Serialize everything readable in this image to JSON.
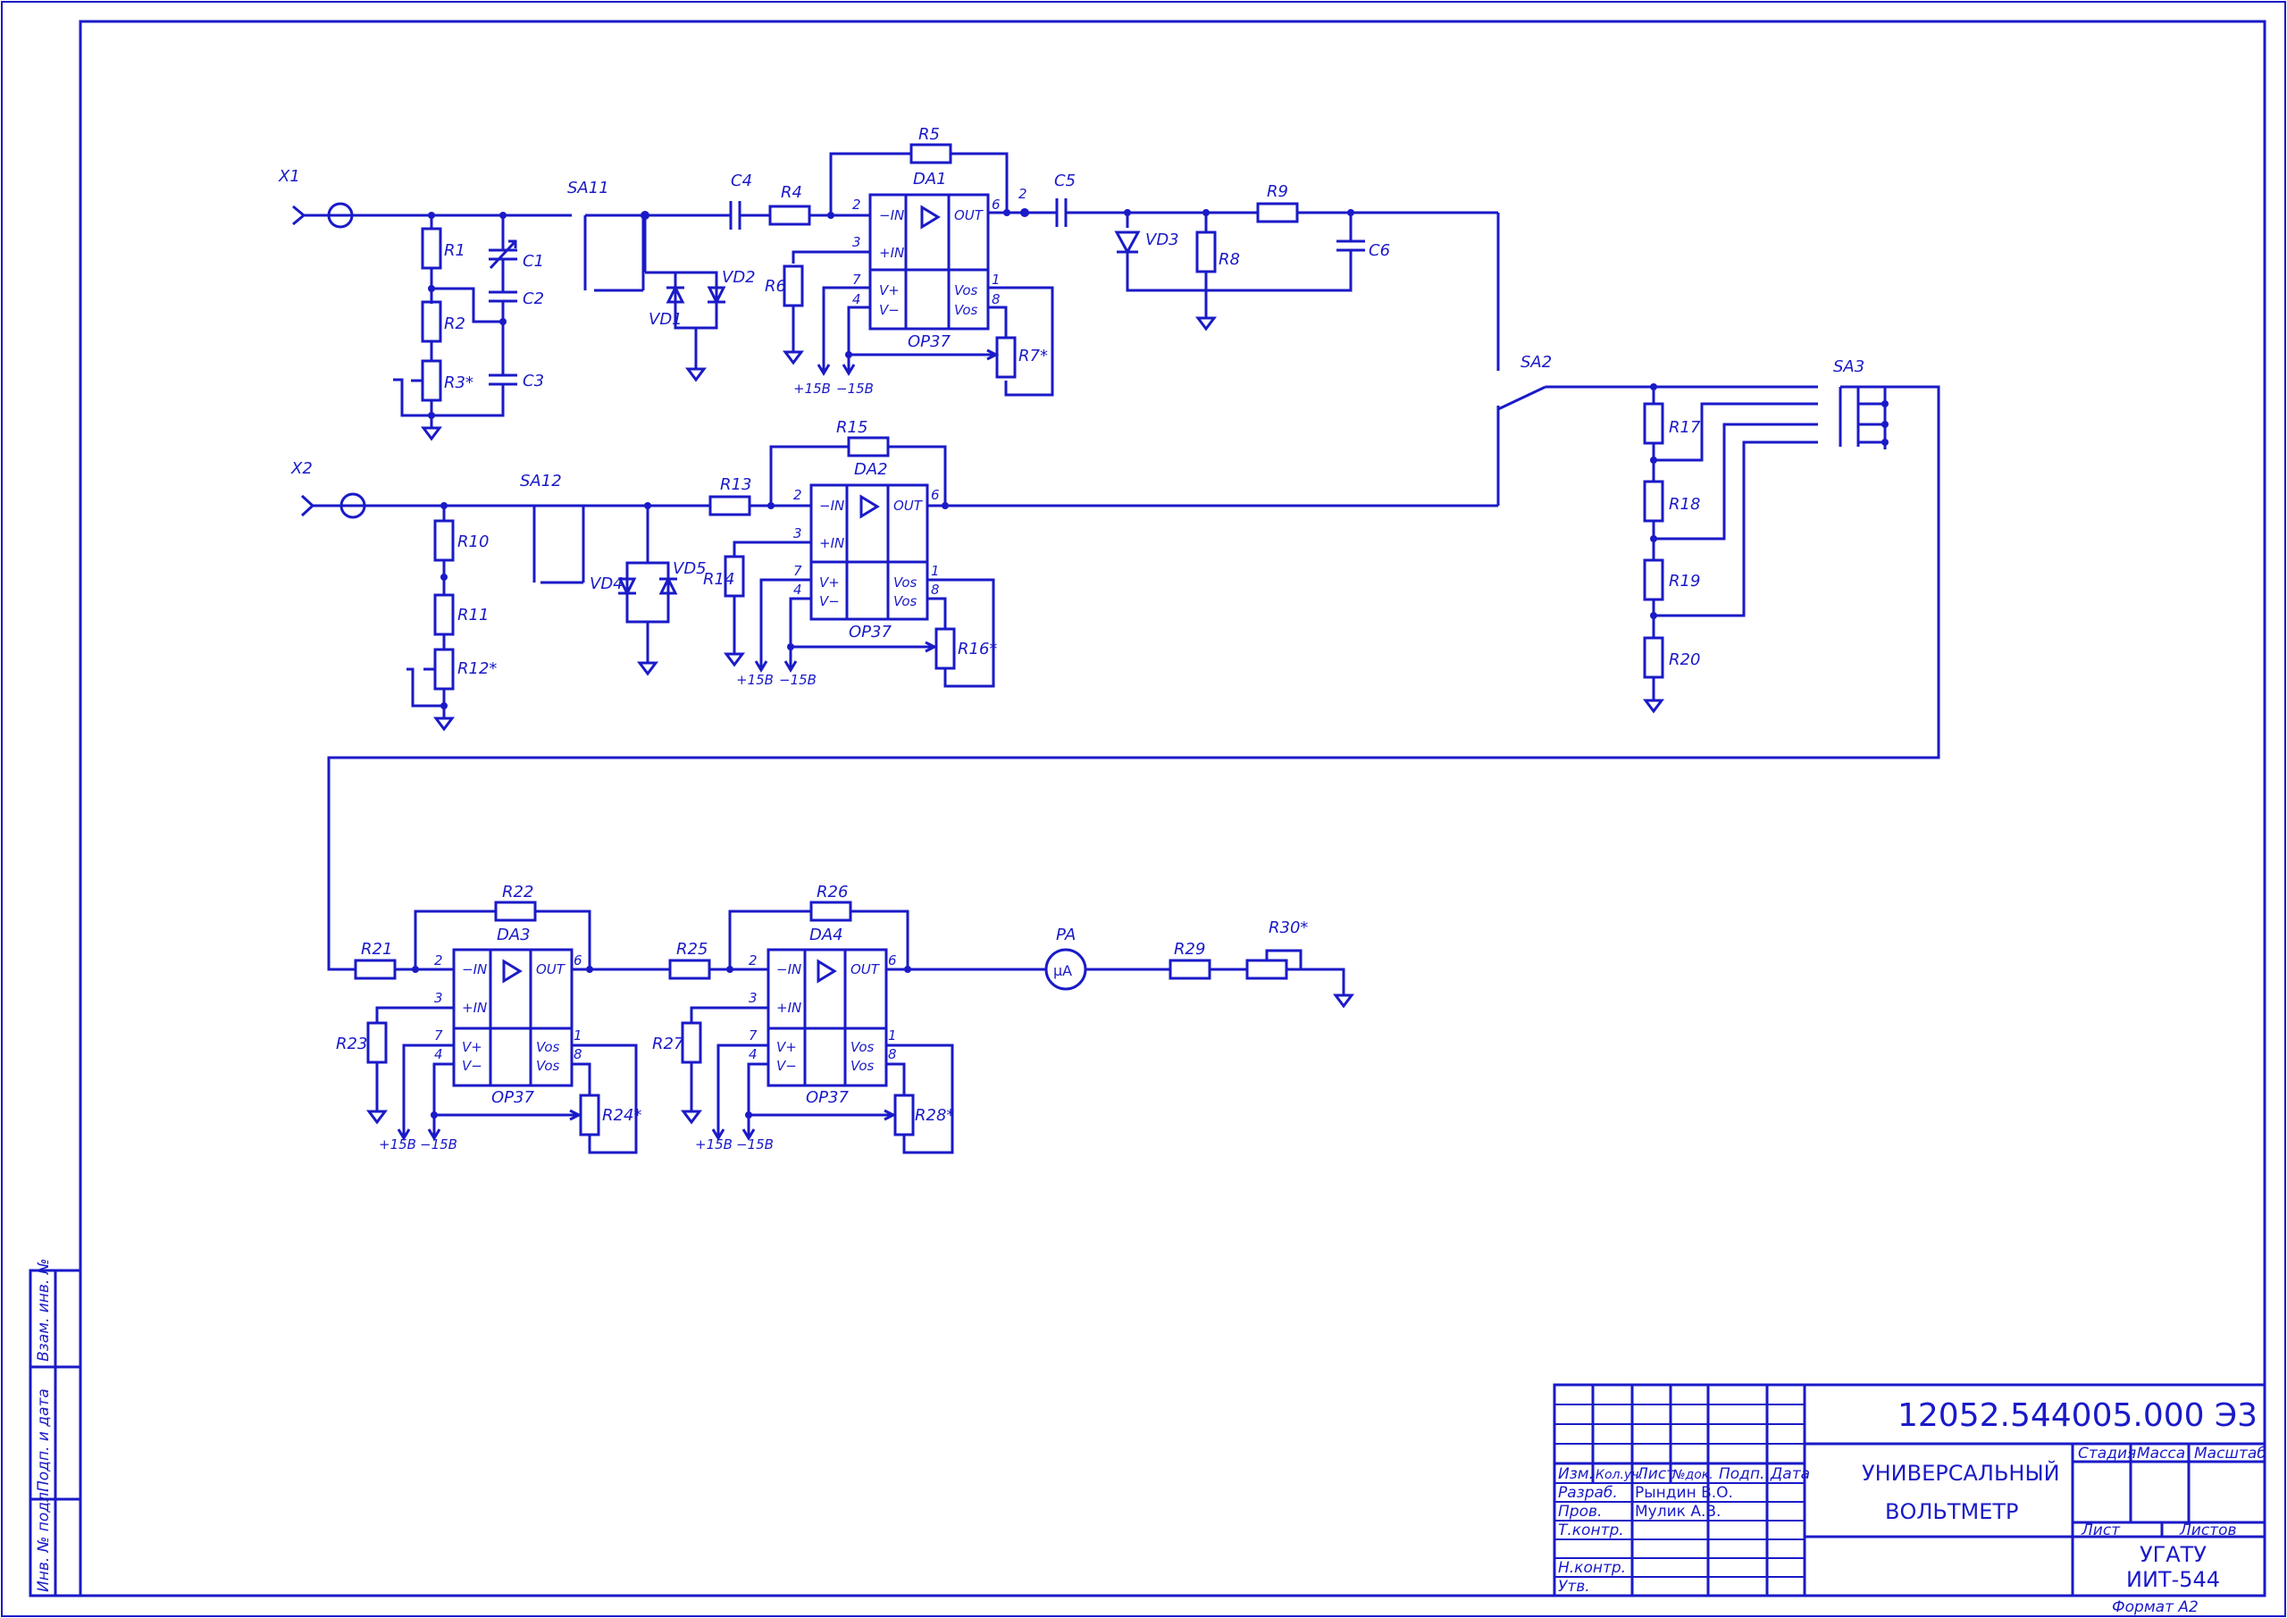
{
  "connectors": {
    "x1": "X1",
    "x2": "X2"
  },
  "components": {
    "r1": "R1",
    "r2": "R2",
    "r3": "R3*",
    "c1": "C1",
    "c2": "C2",
    "c3": "C3",
    "sa11": "SA11",
    "vd1": "VD1",
    "vd2": "VD2",
    "c4": "C4",
    "r4": "R4",
    "r5": "R5",
    "r6": "R6",
    "r7": "R7*",
    "da1": "DA1",
    "c5": "C5",
    "vd3": "VD3",
    "r8": "R8",
    "r9": "R9",
    "c6": "C6",
    "sa2": "SA2",
    "sa3": "SA3",
    "r17": "R17",
    "r18": "R18",
    "r19": "R19",
    "r20": "R20",
    "r10": "R10",
    "r11": "R11",
    "r12": "R12*",
    "sa12": "SA12",
    "vd4": "VD4",
    "vd5": "VD5",
    "r13": "R13",
    "r14": "R14",
    "r15": "R15",
    "r16": "R16*",
    "da2": "DA2",
    "r21": "R21",
    "r22": "R22",
    "r23": "R23",
    "r24": "R24*",
    "da3": "DA3",
    "r25": "R25",
    "r26": "R26",
    "r27": "R27",
    "r28": "R28*",
    "da4": "DA4",
    "pa": "PA",
    "pa_unit": "µA",
    "r29": "R29",
    "r30": "R30*"
  },
  "opamp": {
    "model": "OP37",
    "in_minus": "−IN",
    "in_plus": "+IN",
    "out": "OUT",
    "vplus": "V+",
    "vminus": "V−",
    "vos": "Vos",
    "pin_inm": "2",
    "pin_inp": "3",
    "pin_out": "6",
    "pin_vp": "7",
    "pin_vm": "4",
    "pin_vos1": "1",
    "pin_vos2": "8"
  },
  "supply": {
    "plus": "+15В",
    "minus": "−15В"
  },
  "misc": {
    "pin2": "2"
  },
  "title_block": {
    "designation": "12052.544005.000 Э3",
    "name_line1": "УНИВЕРСАЛЬНЫЙ",
    "name_line2": "ВОЛЬТМЕТР",
    "stage": "Стадия",
    "mass": "Масса",
    "scale": "Масштаб",
    "sheet": "Лист",
    "sheets": "Листов",
    "org_line1": "УГАТУ",
    "org_line2": "ИИТ-544",
    "format": "Формат   А2",
    "col_izm": "Изм.",
    "col_kol": "Кол.уч.",
    "col_list": "Лист",
    "col_doc": "№док.",
    "col_sign": "Подп.",
    "col_date": "Дата",
    "row_dev": "Разраб.",
    "row_check": "Пров.",
    "row_tcontr": "Т.контр.",
    "row_ncontr": "Н.контр.",
    "row_appr": "Утв.",
    "dev_name": "Рындин В.О.",
    "check_name": "Мулик А.В."
  },
  "side_block": {
    "s1": "Взам. инв. №",
    "s2": "Подп. и дата",
    "s3": "Инв. № подл."
  }
}
